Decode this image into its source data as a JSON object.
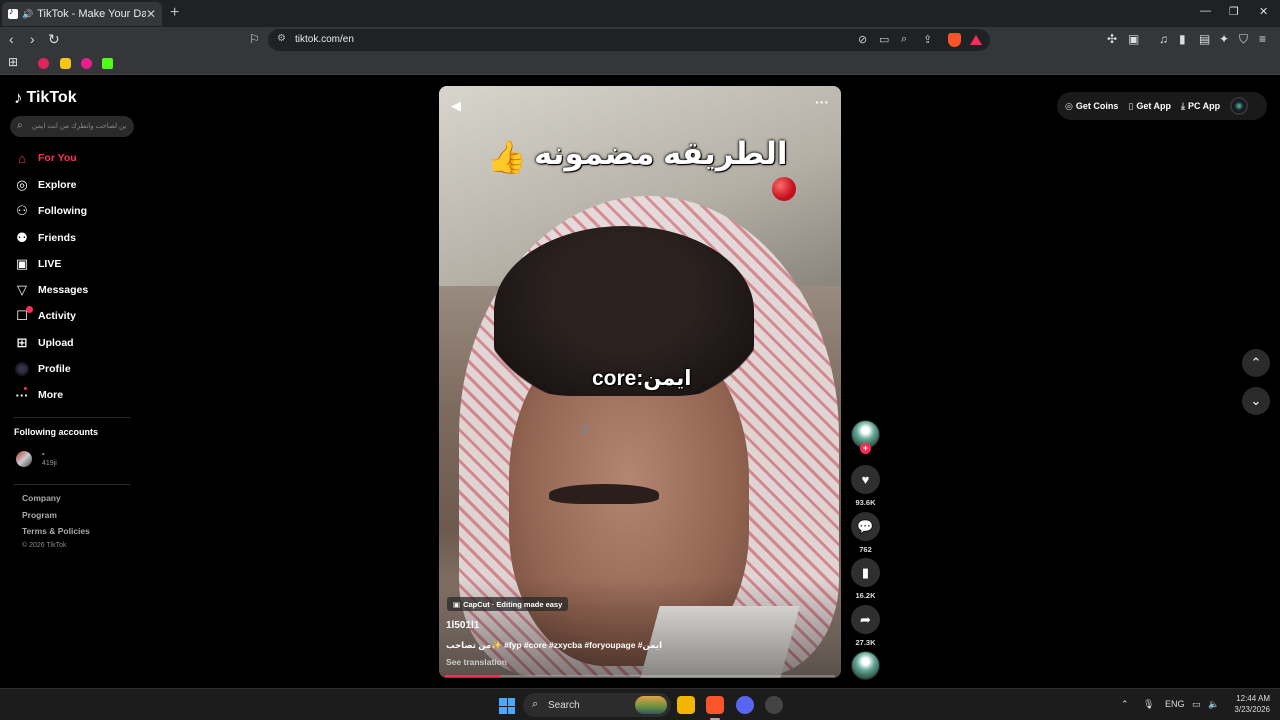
{
  "browser": {
    "tab_title": "TikTok - Make Your Day",
    "new_tab": "+",
    "url": "tiktok.com/en",
    "win_min": "—",
    "win_max": "❐",
    "win_close": "✕"
  },
  "sidebar": {
    "logo": "TikTok",
    "search_placeholder": "ين لصاحب وانطرك من انت ايمن",
    "nav": [
      {
        "label": "For You",
        "icon": "home-icon"
      },
      {
        "label": "Explore",
        "icon": "compass-icon"
      },
      {
        "label": "Following",
        "icon": "following-icon"
      },
      {
        "label": "Friends",
        "icon": "friends-icon"
      },
      {
        "label": "LIVE",
        "icon": "live-icon"
      },
      {
        "label": "Messages",
        "icon": "messages-icon"
      },
      {
        "label": "Activity",
        "icon": "activity-icon"
      },
      {
        "label": "Upload",
        "icon": "upload-icon"
      },
      {
        "label": "Profile",
        "icon": "profile-avatar"
      },
      {
        "label": "More",
        "icon": "more-icon"
      }
    ],
    "following_heading": "Following accounts",
    "following_account": {
      "name": "-",
      "handle": "419ji"
    },
    "footer": [
      "Company",
      "Program",
      "Terms & Policies"
    ],
    "copyright": "© 2026 TikTok"
  },
  "topright": {
    "get_coins": "Get Coins",
    "get_app": "Get App",
    "pc_app": "PC App"
  },
  "video": {
    "overlay_title": "الطريقه مضمونه",
    "overlay_core": "core:ايمن",
    "capcut": "CapCut · Editing made easy",
    "author": "1l501l1",
    "caption": "من تصاحب✨ #fyp #core #zxycba #foryoupage #ايمن",
    "see_translation": "See translation",
    "progress": 0.14
  },
  "actions": {
    "likes": "93.6K",
    "comments": "762",
    "saves": "16.2K",
    "shares": "27.3K"
  },
  "taskbar": {
    "search": "Search",
    "lang": "ENG",
    "time": "12:44 AM",
    "date": "3/23/2026"
  },
  "colors": {
    "accent": "#fe2c55",
    "background": "#000000"
  }
}
